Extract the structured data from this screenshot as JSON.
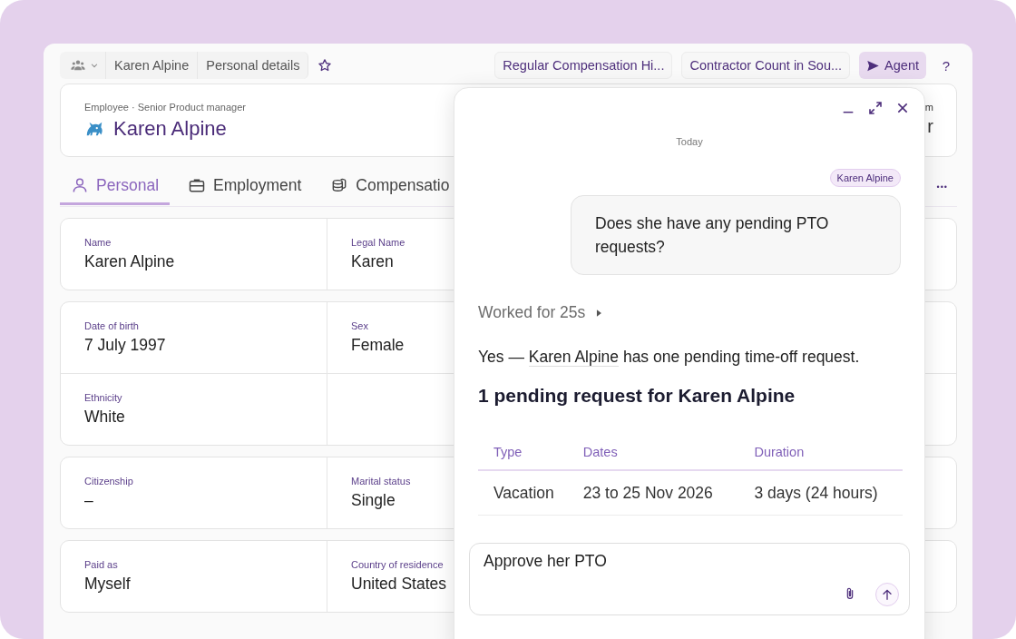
{
  "breadcrumbs": [
    {
      "label": "Karen Alpine"
    },
    {
      "label": "Personal details"
    }
  ],
  "favorite": {
    "on": false
  },
  "saved_reports": [
    "Regular Compensation Hi...",
    "Contractor Count in Sou..."
  ],
  "agent_button": {
    "label": "Agent",
    "active": true
  },
  "help_button": {
    "label": "?"
  },
  "header": {
    "subtitle": "Employee · Senior Product manager",
    "name": "Karen Alpine",
    "side_label": "m",
    "side_value": "r"
  },
  "tabs": [
    {
      "label": "Personal",
      "selected": true
    },
    {
      "label": "Employment",
      "selected": false
    },
    {
      "label": "Compensatio",
      "selected": false
    }
  ],
  "more_button": {
    "label": "•••"
  },
  "field_groups": [
    {
      "rows": [
        [
          {
            "label": "Name",
            "value": "Karen Alpine"
          },
          {
            "label": "Legal Name",
            "value": "Karen"
          }
        ]
      ]
    },
    {
      "rows": [
        [
          {
            "label": "Date of birth",
            "value": "7 July 1997"
          },
          {
            "label": "Sex",
            "value": "Female"
          }
        ],
        [
          {
            "label": "Ethnicity",
            "value": "White"
          }
        ]
      ]
    },
    {
      "rows": [
        [
          {
            "label": "Citizenship",
            "value": "–"
          },
          {
            "label": "Marital status",
            "value": "Single"
          }
        ]
      ]
    },
    {
      "rows": [
        [
          {
            "label": "Paid as",
            "value": "Myself"
          },
          {
            "label": "Country of residence",
            "value": "United States"
          }
        ]
      ]
    }
  ],
  "chat": {
    "day": "Today",
    "user_tag": "Karen Alpine",
    "user_message": "Does she have any pending PTO requests?",
    "worked": "Worked for 25s",
    "answer": [
      {
        "text": "Yes — "
      },
      {
        "text": "Karen Alpine",
        "kind": "link"
      },
      {
        "text": " has one pending time-off request."
      }
    ],
    "heading": "1 pending request for Karen Alpine",
    "table": {
      "columns": [
        "Type",
        "Dates",
        "Duration"
      ],
      "rows": [
        [
          "Vacation",
          "23 to 25 Nov 2026",
          "3 days (24 hours)"
        ]
      ]
    },
    "composer": {
      "value": "Approve her PTO"
    }
  }
}
